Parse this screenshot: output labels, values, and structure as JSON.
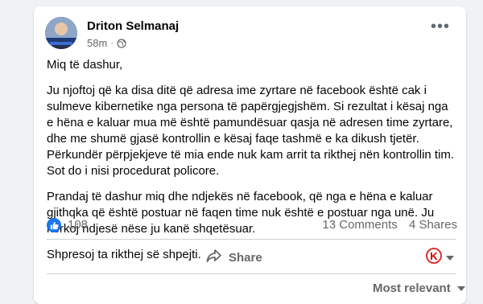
{
  "post": {
    "author": "Driton Selmanaj",
    "time": "58m",
    "separator": "·",
    "privacy_icon": "globe-icon",
    "more_icon": "more-dots-icon",
    "paragraphs": [
      "Miq të dashur,",
      "Ju njoftoj që ka disa ditë që adresa ime zyrtare në facebook është cak i sulmeve kibernetike nga persona të papërgjegjshëm. Si rezultat i kësaj nga e hëna e kaluar mua më është pamundësuar qasja në adresen time zyrtare, dhe me shumë gjasë kontrollin e kësaj faqe tashmë e ka dikush tjetër. Përkundër përpjekjeve të mia ende nuk kam arrit ta rikthej nën kontrollin tim. Sot do i nisi procedurat policore.",
      "Prandaj të dashur miq dhe ndjekës në facebook, që nga e hëna e kaluar gjithqka që është postuar në faqen time nuk është e postuar nga unë. Ju kërkoj ndjesë nëse ju kanë shqetësuar.",
      "Shpresoj ta rikthej së shpejti."
    ]
  },
  "stats": {
    "likes": "108",
    "comments": "13 Comments",
    "shares": "4 Shares"
  },
  "actions": {
    "share_label": "Share",
    "profile_badge_letter": "K"
  },
  "comments": {
    "sort_label": "Most relevant"
  },
  "colors": {
    "accent": "#1877f2",
    "text": "#050505",
    "muted": "#65676b",
    "background": "#f0f2f5"
  }
}
